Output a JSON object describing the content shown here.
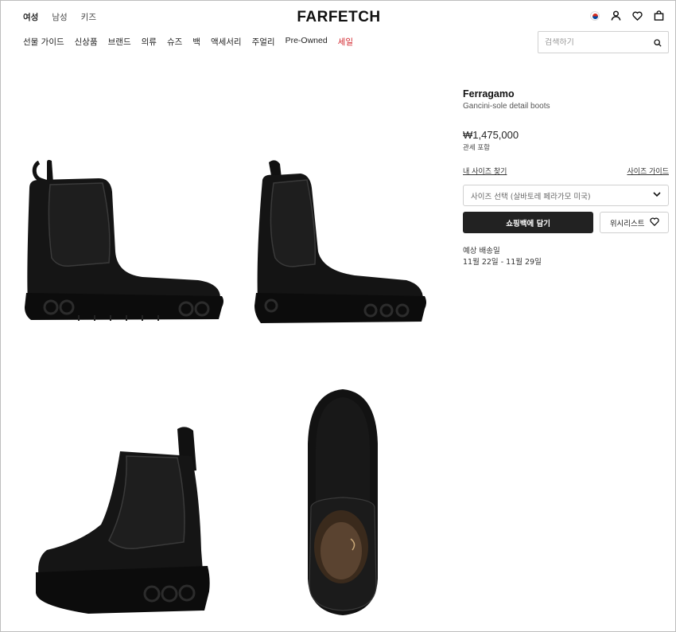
{
  "header": {
    "gender_tabs": [
      "여성",
      "남성",
      "키즈"
    ],
    "logo": "FARFETCH",
    "icons": [
      "korea-flag-icon",
      "account-icon",
      "heart-icon",
      "shopping-bag-icon"
    ]
  },
  "nav": {
    "items": [
      "선물 가이드",
      "신상품",
      "브랜드",
      "의류",
      "슈즈",
      "백",
      "액세서리",
      "주얼리",
      "Pre-Owned",
      "세일"
    ]
  },
  "search": {
    "placeholder": "검색하기"
  },
  "product": {
    "brand": "Ferragamo",
    "name": "Gancini-sole detail boots",
    "price": "₩1,475,000",
    "tax_note": "관세 포함",
    "find_size": "내 사이즈 찾기",
    "size_guide": "사이즈 가이드",
    "size_select": "사이즈 선택 (살바토레 페라가모 미국)",
    "add_to_bag": "쇼핑백에 담기",
    "wishlist": "위시리스트",
    "delivery_label": "예상 배송일",
    "delivery_dates": "11월 22일 - 11월 29일"
  },
  "colors": {
    "accent": "#222222",
    "sale": "#d1232a"
  }
}
